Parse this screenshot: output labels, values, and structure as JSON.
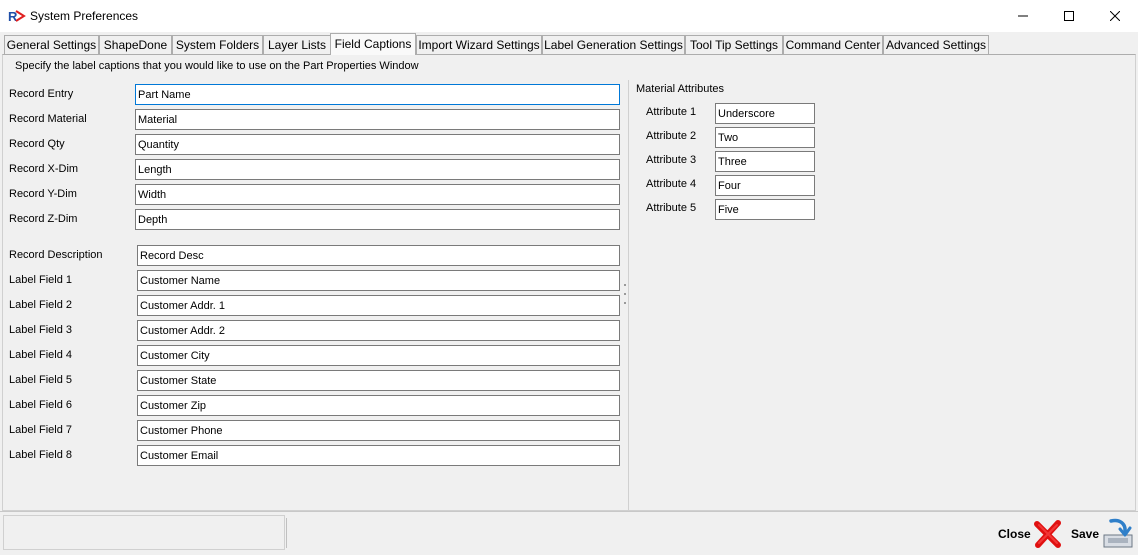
{
  "window": {
    "title": "System Preferences"
  },
  "tabs": [
    {
      "label": "General Settings"
    },
    {
      "label": "ShapeDone"
    },
    {
      "label": "System Folders"
    },
    {
      "label": "Layer Lists"
    },
    {
      "label": "Field Captions",
      "active": true
    },
    {
      "label": "Import Wizard Settings"
    },
    {
      "label": "Label Generation Settings"
    },
    {
      "label": "Tool Tip Settings"
    },
    {
      "label": "Command Center"
    },
    {
      "label": "Advanced Settings"
    }
  ],
  "intro": "Specify the label captions that you would like to use on the Part Properties Window",
  "records": [
    {
      "label": "Record Entry",
      "value": "Part Name"
    },
    {
      "label": "Record Material",
      "value": "Material"
    },
    {
      "label": "Record Qty",
      "value": "Quantity"
    },
    {
      "label": "Record X-Dim",
      "value": "Length"
    },
    {
      "label": "Record Y-Dim",
      "value": "Width"
    },
    {
      "label": "Record Z-Dim",
      "value": "Depth"
    }
  ],
  "label_fields": [
    {
      "label": "Record Description",
      "value": "Record Desc"
    },
    {
      "label": "Label Field 1",
      "value": "Customer Name"
    },
    {
      "label": "Label Field 2",
      "value": "Customer Addr. 1"
    },
    {
      "label": "Label Field 3",
      "value": "Customer Addr. 2"
    },
    {
      "label": "Label Field 4",
      "value": "Customer City"
    },
    {
      "label": "Label Field 5",
      "value": "Customer State"
    },
    {
      "label": "Label Field 6",
      "value": "Customer Zip"
    },
    {
      "label": "Label Field 7",
      "value": "Customer Phone"
    },
    {
      "label": "Label Field 8",
      "value": "Customer Email"
    }
  ],
  "material_attributes": {
    "title": "Material Attributes",
    "items": [
      {
        "label": "Attribute 1",
        "value": "Underscore"
      },
      {
        "label": "Attribute 2",
        "value": "Two"
      },
      {
        "label": "Attribute 3",
        "value": "Three"
      },
      {
        "label": "Attribute 4",
        "value": "Four"
      },
      {
        "label": "Attribute 5",
        "value": "Five"
      }
    ]
  },
  "footer": {
    "close_label": "Close",
    "save_label": "Save"
  },
  "icons": {
    "app": "app-logo-icon",
    "minimize": "minimize-icon",
    "maximize": "maximize-icon",
    "close_window": "close-window-icon",
    "close": "red-x-icon",
    "save": "save-disk-icon"
  },
  "colors": {
    "focus_border": "#0078d7",
    "close_icon": "#e01010",
    "save_icon": "#2f7fc9"
  }
}
